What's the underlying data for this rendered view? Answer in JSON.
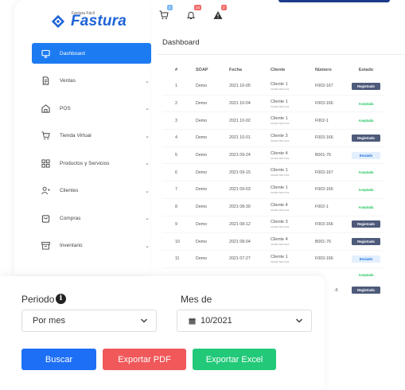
{
  "brand": {
    "tagline": "Factura Fácil",
    "name": "Fastura",
    "accent": "#1d7bf2"
  },
  "topbar": {
    "icons": [
      {
        "icon": "cart-icon",
        "badge": "2",
        "badge_color": "#7ab8f5"
      },
      {
        "icon": "bell-icon",
        "badge": "14",
        "badge_color": "#f26b6b"
      },
      {
        "icon": "warning-icon",
        "badge": "2",
        "badge_color": "#f26b6b"
      }
    ]
  },
  "sidebar": {
    "items": [
      {
        "label": "Dashboard",
        "icon": "monitor-icon",
        "active": true
      },
      {
        "label": "Ventas",
        "icon": "document-icon",
        "chevron": true
      },
      {
        "label": "POS",
        "icon": "store-icon",
        "chevron": true
      },
      {
        "label": "Tienda Virtual",
        "icon": "cart-icon",
        "chevron": true
      },
      {
        "label": "Productos y Servicios",
        "icon": "grid-icon",
        "chevron": true
      },
      {
        "label": "Clientes",
        "icon": "users-icon",
        "chevron": true
      },
      {
        "label": "Compras",
        "icon": "bag-icon",
        "chevron": true
      },
      {
        "label": "Inventario",
        "icon": "archive-icon",
        "chevron": true
      }
    ]
  },
  "main": {
    "title": "Dashboard",
    "table": {
      "headers": [
        "#",
        "SOAP",
        "Fecha",
        "Cliente",
        "Número",
        "Estado"
      ],
      "rows": [
        {
          "n": "1",
          "soap": "Demo",
          "fecha": "2021 10-05",
          "cliente": "Cliente 1",
          "cliente_sub": "912090 848 2344",
          "numero": "F003-167",
          "estado": "Registrado"
        },
        {
          "n": "2",
          "soap": "Demo",
          "fecha": "2021 10-04",
          "cliente": "Cliente 1",
          "cliente_sub": "912090 848 2344",
          "numero": "F003-166",
          "estado": "Aceptada"
        },
        {
          "n": "3",
          "soap": "Demo",
          "fecha": "2021 10-02",
          "cliente": "Cliente 1",
          "cliente_sub": "912090 848 2344",
          "numero": "F002-1",
          "estado": "Aceptada"
        },
        {
          "n": "4",
          "soap": "Demo",
          "fecha": "2021 10-01",
          "cliente": "Cliente 3",
          "cliente_sub": "912300 829 2322",
          "numero": "F003-166",
          "estado": "Registrado"
        },
        {
          "n": "5",
          "soap": "Demo",
          "fecha": "2021 09-24",
          "cliente": "Cliente 4",
          "cliente_sub": "427000 848 2344",
          "numero": "B001-76",
          "estado": "Enviado"
        },
        {
          "n": "6",
          "soap": "Demo",
          "fecha": "2021 09-15",
          "cliente": "Cliente 1",
          "cliente_sub": "912090 848 2344",
          "numero": "F003-167",
          "estado": "Aceptada"
        },
        {
          "n": "7",
          "soap": "Demo",
          "fecha": "2021 09-03",
          "cliente": "Cliente 1",
          "cliente_sub": "912090 848 2344",
          "numero": "F003-166",
          "estado": "Aceptada"
        },
        {
          "n": "8",
          "soap": "Demo",
          "fecha": "2021 08-30",
          "cliente": "Cliente 4",
          "cliente_sub": "912090 848 2344",
          "numero": "F002-1",
          "estado": "Aceptada"
        },
        {
          "n": "9",
          "soap": "Demo",
          "fecha": "2021 08-12",
          "cliente": "Cliente 3",
          "cliente_sub": "912300 829 2322",
          "numero": "F003-166",
          "estado": "Registrado"
        },
        {
          "n": "10",
          "soap": "Demo",
          "fecha": "2021 08-04",
          "cliente": "Cliente 4",
          "cliente_sub": "427000 848 2344",
          "numero": "B001-76",
          "estado": "Registrado"
        },
        {
          "n": "11",
          "soap": "Demo",
          "fecha": "2021 07-27",
          "cliente": "Cliente 1",
          "cliente_sub": "912090 848 2344",
          "numero": "F003-166",
          "estado": "Enviado"
        }
      ],
      "extra_estado": [
        "Aceptada",
        "Registrado"
      ],
      "extra_numero": "-6"
    }
  },
  "filter": {
    "periodo_label": "Periodo",
    "periodo_value": "Por mes",
    "mes_label": "Mes de",
    "mes_value": "10/2021",
    "buttons": {
      "buscar": "Buscar",
      "exportar_pdf": "Exportar PDF",
      "exportar_excel": "Exportar Excel"
    }
  },
  "estado_colors": {
    "Registrado": {
      "bg": "#4d5a7a",
      "fg": "#ffffff"
    },
    "Aceptada": {
      "bg": "#ffffff",
      "fg": "#22c55e"
    },
    "Enviado": {
      "bg": "#e3effd",
      "fg": "#1d6fd8"
    }
  }
}
